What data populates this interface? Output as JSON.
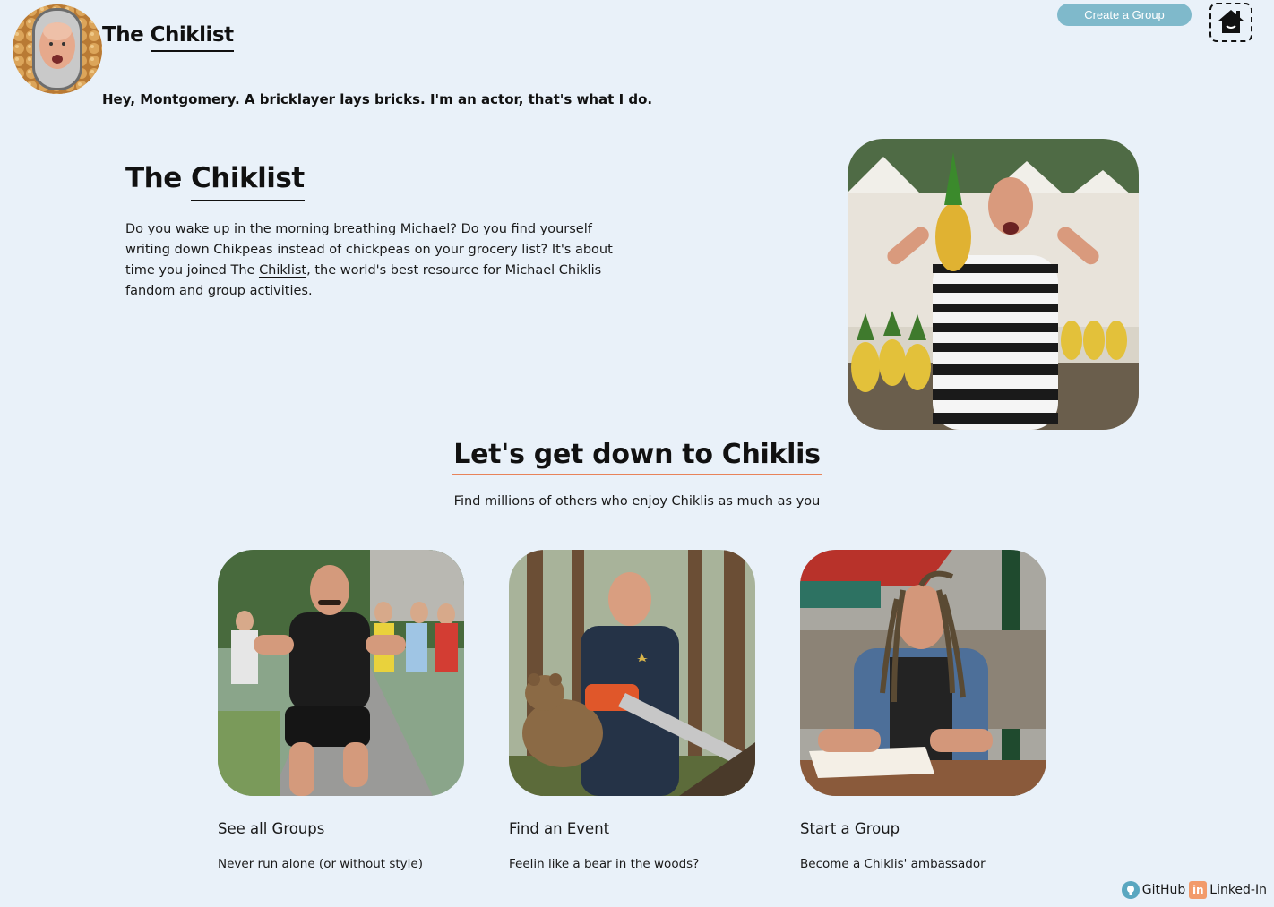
{
  "header": {
    "site_title_prefix": "The ",
    "site_title_word": "Chiklist",
    "tagline": "Hey, Montgomery. A bricklayer lays bricks. I'm an actor, that's what I do.",
    "create_group_label": "Create a Group",
    "home_icon": "home-icon"
  },
  "intro": {
    "title_prefix": "The ",
    "title_word": "Chiklist",
    "text_part1": "Do you wake up in the morning breathing Michael? Do you find yourself writing down Chikpeas instead of chickpeas on your grocery list? It's about time you joined The ",
    "text_word": "Chiklist",
    "text_part2": ", the world's best resource for Michael Chiklis fandom and group activities."
  },
  "section": {
    "title": "Let's get down to Chiklis",
    "subtitle": "Find millions of others who enjoy Chiklis as much as you"
  },
  "cards": [
    {
      "title": "See all Groups",
      "desc": "Never run alone (or without style)"
    },
    {
      "title": "Find an Event",
      "desc": "Feelin like a bear in the woods?"
    },
    {
      "title": "Start a Group",
      "desc": "Become a Chiklis' ambassador"
    }
  ],
  "footer": {
    "github_label": "GitHub",
    "linkedin_label": "Linked-In"
  },
  "colors": {
    "background": "#e9f1f9",
    "button": "#7fb9cb",
    "accent_underline": "#e8835a"
  }
}
